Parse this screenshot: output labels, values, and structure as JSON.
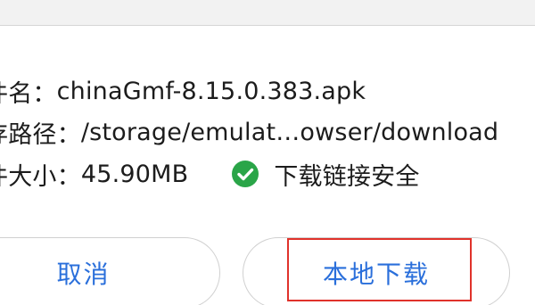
{
  "file_info": {
    "name_label": "件名：",
    "name_value": "chinaGmf-8.15.0.383.apk",
    "path_label": "存路径：",
    "path_value": "/storage/emulat…owser/download",
    "size_label": "件大小：",
    "size_value": "45.90MB",
    "safety_text": "下载链接安全",
    "safety_icon": "check-circle-icon",
    "safety_color": "#2aa548"
  },
  "buttons": {
    "cancel_label": "取消",
    "download_label": "本地下载",
    "accent_color": "#2a6fdb",
    "highlight_color": "#e0322b"
  }
}
